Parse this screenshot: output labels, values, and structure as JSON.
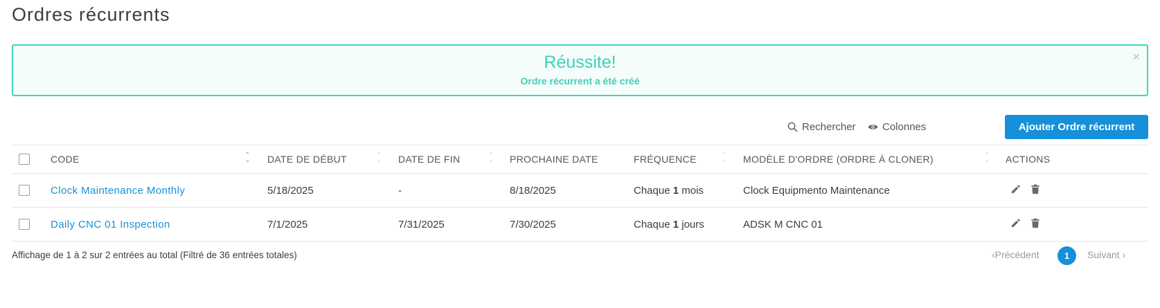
{
  "page": {
    "title": "Ordres récurrents"
  },
  "alert": {
    "title": "Réussite!",
    "message": "Ordre récurrent a été créé",
    "close": "×"
  },
  "toolbar": {
    "search_label": "Rechercher",
    "columns_label": "Colonnes",
    "add_label": "Ajouter Ordre récurrent"
  },
  "table": {
    "headers": {
      "code": "CODE",
      "start_date": "DATE DE DÉBUT",
      "end_date": "DATE DE FIN",
      "next_date": "PROCHAINE DATE",
      "frequency": "FRÉQUENCE",
      "template": "MODÈLE D'ORDRE (ORDRE À CLONER)",
      "actions": "ACTIONS"
    },
    "rows": [
      {
        "code": "Clock Maintenance Monthly",
        "start_date": "5/18/2025",
        "end_date": "-",
        "next_date": "8/18/2025",
        "freq_prefix": "Chaque",
        "freq_num": "1",
        "freq_unit": "mois",
        "template": "Clock Equipmento Maintenance"
      },
      {
        "code": "Daily CNC 01 Inspection",
        "start_date": "7/1/2025",
        "end_date": "7/31/2025",
        "next_date": "7/30/2025",
        "freq_prefix": "Chaque",
        "freq_num": "1",
        "freq_unit": "jours",
        "template": "ADSK M CNC 01"
      }
    ]
  },
  "footer": {
    "info": "Affichage de 1 à 2 sur 2 entrées au total (Filtré de 36 entrées totales)",
    "prev": "Précédent",
    "next": "Suivant",
    "current_page": "1"
  },
  "colors": {
    "accent": "#1590d9",
    "success": "#3ed0b4"
  },
  "icons": [
    "search-icon",
    "eye-icon",
    "close-icon",
    "edit-icon",
    "trash-icon",
    "sort-icon",
    "chevron-left-icon",
    "chevron-right-icon"
  ]
}
